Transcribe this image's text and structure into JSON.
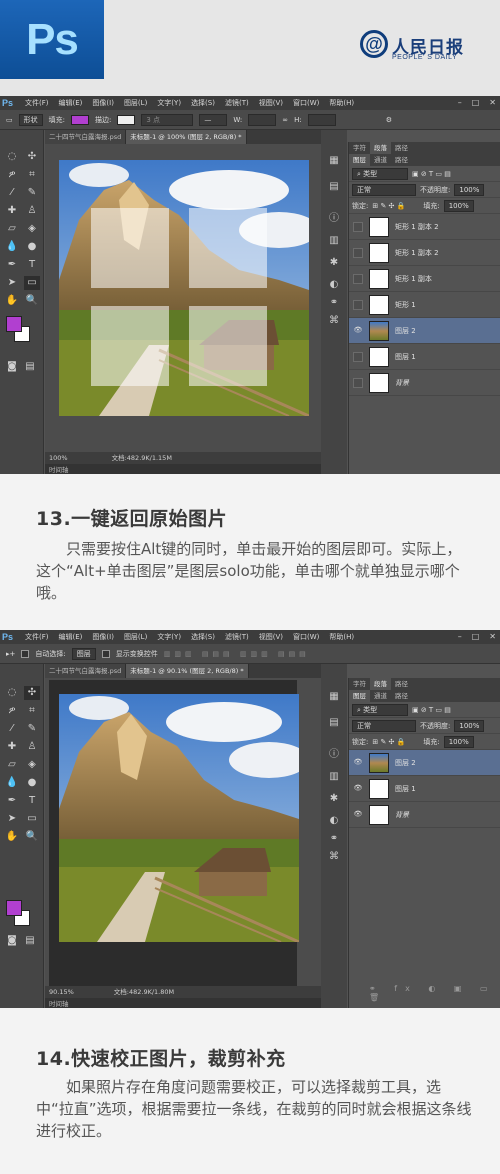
{
  "header": {
    "ps_logo": "Ps",
    "brand_cn": "人民日报",
    "brand_en": "PEOPLE' S DAILY",
    "brand_at": "@"
  },
  "colors": {
    "fg_swatch": "#b13fd0",
    "selected_layer": "#5a6f92",
    "ps_blue": "#1d66b8"
  },
  "menus": {
    "app": "Ps",
    "items": [
      "文件(F)",
      "编辑(E)",
      "图像(I)",
      "图层(L)",
      "文字(Y)",
      "选择(S)",
      "滤镜(T)",
      "视图(V)",
      "窗口(W)",
      "帮助(H)"
    ]
  },
  "shot1": {
    "options": {
      "shape_mode": "形状",
      "fill_label": "填充:",
      "stroke_label": "描边:",
      "stroke_width": "3 点",
      "w_label": "W:",
      "h_label": "H:"
    },
    "tabs": [
      "二十四节气白露海报.psd",
      "未标题-1 @ 100% (图层 2, RGB/8) *"
    ],
    "status_zoom": "100%",
    "status_doc": "文档:482.9K/1.15M",
    "timeline": "时间轴",
    "panel_tabs": [
      "字符",
      "段落",
      "路径"
    ],
    "layers_tabs": [
      "图层",
      "通道",
      "路径"
    ],
    "filter": "类型",
    "blend": "正常",
    "opacity_label": "不透明度:",
    "opacity": "100%",
    "lock_label": "锁定:",
    "fill_label": "填充:",
    "fill": "100%",
    "layers": [
      "矩形 1 副本 2",
      "矩形 1 副本 2",
      "矩形 1 副本",
      "矩形 1",
      "图层 2",
      "图层 1",
      "背景"
    ]
  },
  "section13": {
    "title": "13.一键返回原始图片",
    "body": "只需要按住Alt键的同时，单击最开始的图层即可。实际上，这个“Alt+单击图层”是图层solo功能，单击哪个就单独显示哪个哦。"
  },
  "shot2": {
    "options": {
      "auto_select": "自动选择:",
      "auto_select_value": "图层",
      "show_transform": "显示变换控件"
    },
    "tabs": [
      "二十四节气白露海报.psd",
      "未标题-1 @ 90.1% (图层 2, RGB/8) *"
    ],
    "status_zoom": "90.15%",
    "status_doc": "文档:482.9K/1.80M",
    "timeline": "时间轴",
    "panel_tabs": [
      "字符",
      "段落",
      "路径"
    ],
    "layers_tabs": [
      "图层",
      "通道",
      "路径"
    ],
    "filter": "类型",
    "blend": "正常",
    "opacity_label": "不透明度:",
    "opacity": "100%",
    "lock_label": "锁定:",
    "fill_label": "填充:",
    "fill": "100%",
    "layers": [
      "图层 2",
      "图层 1",
      "背景"
    ]
  },
  "section14": {
    "title": "14.快速校正图片，裁剪补充",
    "body": "如果照片存在角度问题需要校正，可以选择裁剪工具，选中“拉直”选项，根据需要拉一条线，在裁剪的同时就会根据这条线进行校正。"
  }
}
